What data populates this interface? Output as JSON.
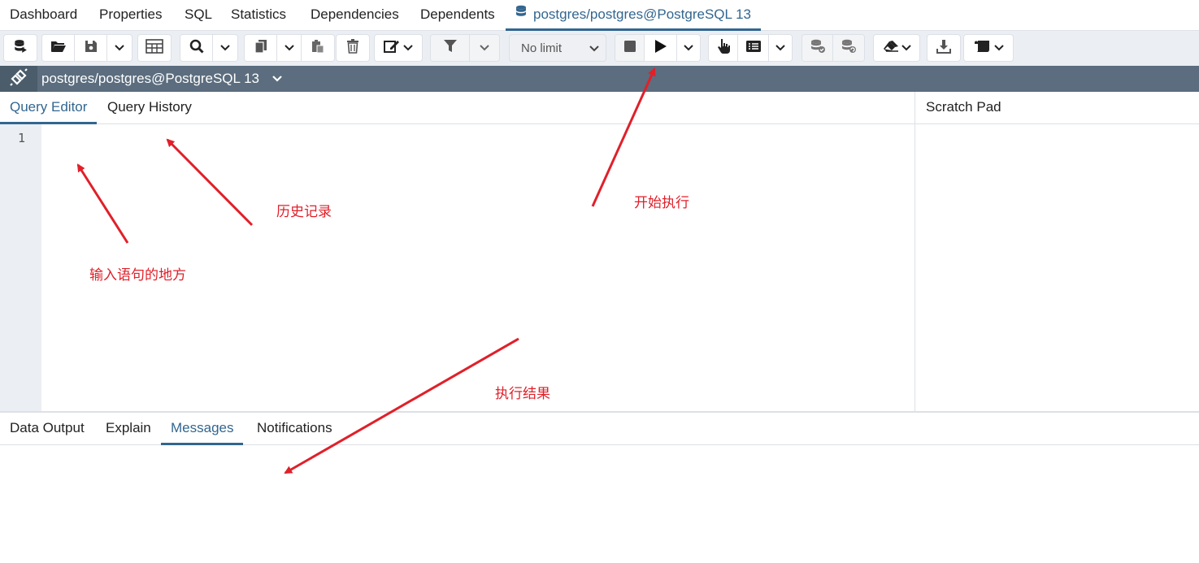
{
  "top_tabs": {
    "dashboard": "Dashboard",
    "properties": "Properties",
    "sql": "SQL",
    "statistics": "Statistics",
    "dependencies": "Dependencies",
    "dependents": "Dependents",
    "query_tool": "postgres/postgres@PostgreSQL 13"
  },
  "toolbar": {
    "limit_value": "No limit"
  },
  "connection": {
    "label": "postgres/postgres@PostgreSQL 13"
  },
  "editor": {
    "tabs": [
      "Query Editor",
      "Query History"
    ],
    "active_tab": "Query Editor",
    "line_number": "1",
    "scratch_pad_title": "Scratch Pad"
  },
  "results": {
    "tabs": [
      "Data Output",
      "Explain",
      "Messages",
      "Notifications"
    ],
    "active_tab": "Messages"
  },
  "annotations": {
    "history": "历史记录",
    "input_area": "输入语句的地方",
    "execute": "开始执行",
    "result": "执行结果"
  },
  "colors": {
    "accent": "#326690",
    "connection_bar": "#5b6d7e",
    "annotation": "#e0202a"
  }
}
